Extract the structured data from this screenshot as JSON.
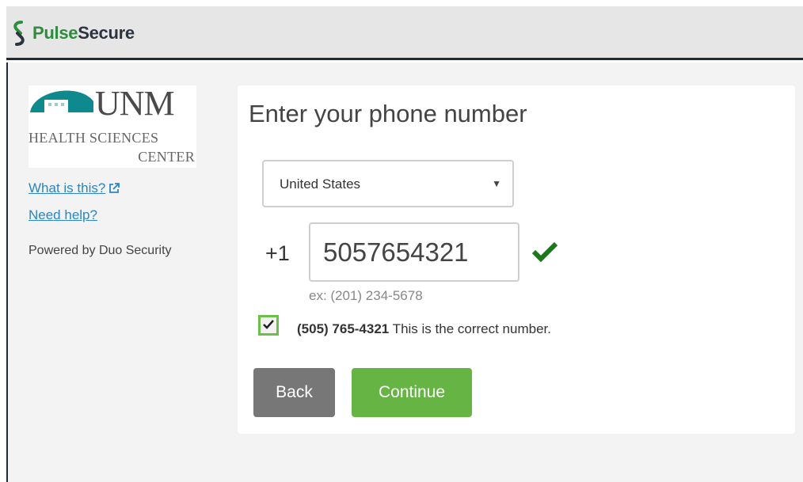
{
  "header": {
    "brand_pulse": "Pulse",
    "brand_secure": "Secure",
    "logo_icon": "pulse-secure-logo-icon"
  },
  "sidebar": {
    "logo": {
      "org": "UNM",
      "line1": "HEALTH SCIENCES",
      "line2": "CENTER"
    },
    "what_is_this": "What is this?",
    "need_help": "Need help?",
    "powered_by": "Powered by Duo Security"
  },
  "form": {
    "heading": "Enter your phone number",
    "country": "United States",
    "country_prefix": "+1",
    "phone_value": "5057654321",
    "example": "ex: (201) 234-5678",
    "confirm_number": "(505) 765-4321",
    "confirm_text": " This is the correct number.",
    "confirm_checked": true,
    "back_label": "Back",
    "continue_label": "Continue"
  },
  "colors": {
    "accent_green": "#66b444",
    "back_gray": "#777777",
    "link_blue": "#2b86c5",
    "header_bar": "#e6e6e6",
    "checkmark_green": "#1a7a1a"
  }
}
